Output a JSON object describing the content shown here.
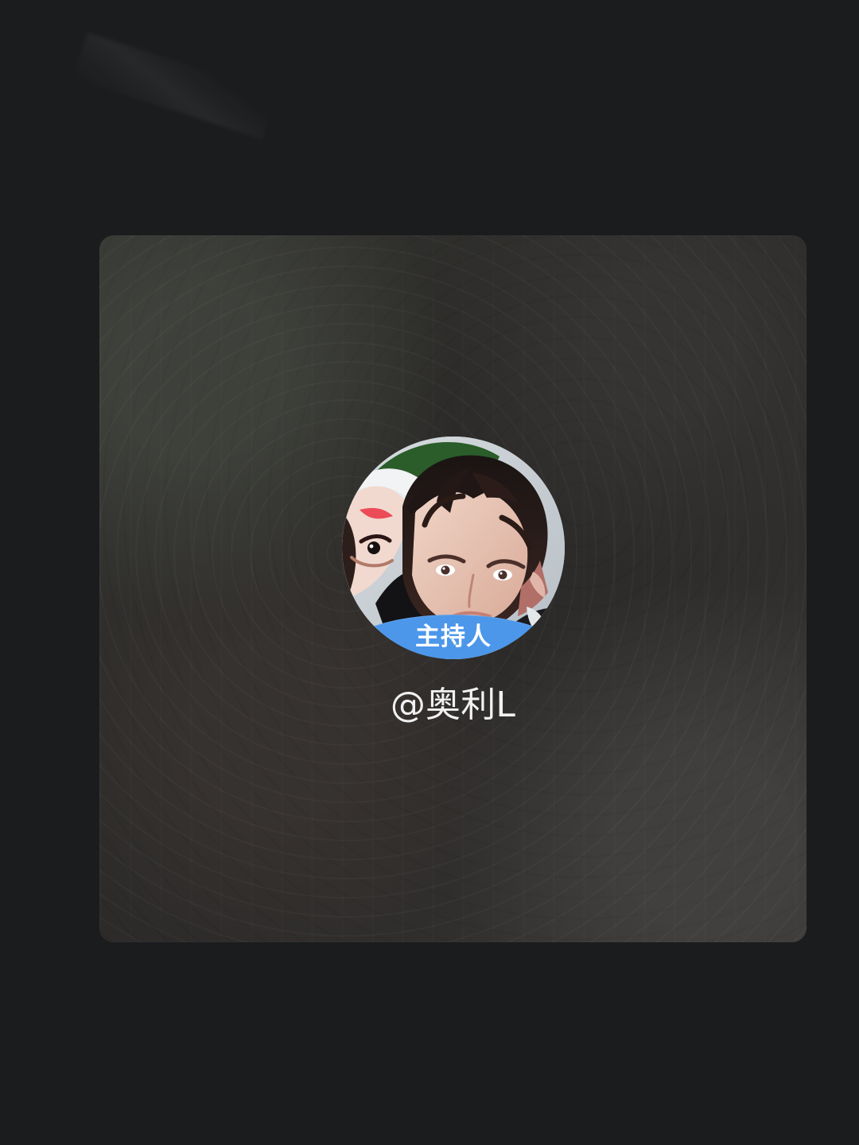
{
  "card": {
    "role_badge": "主持人",
    "username": "@奥利L"
  },
  "avatar": {
    "icon": "user-photo"
  },
  "colors": {
    "page_background": "#1b1c1e",
    "card_background": "#2f2e2c",
    "badge": "#4c97ea",
    "username_text": "#f1f1f1"
  }
}
